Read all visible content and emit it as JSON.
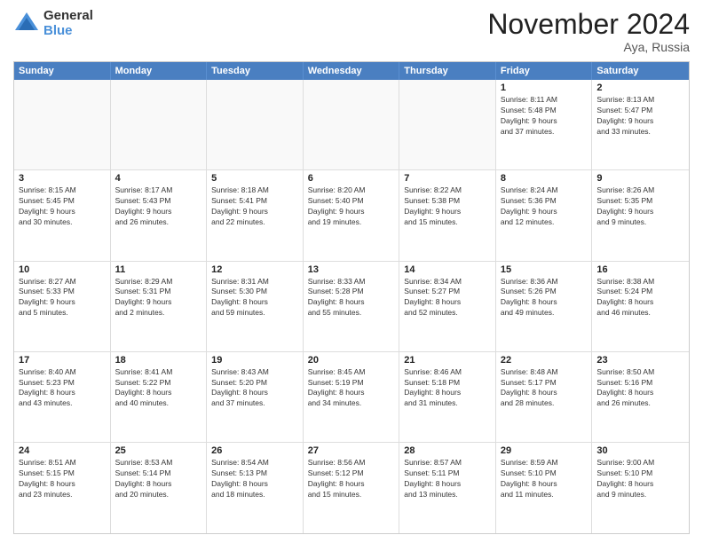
{
  "header": {
    "logo_general": "General",
    "logo_blue": "Blue",
    "title": "November 2024",
    "location": "Aya, Russia"
  },
  "calendar": {
    "days_of_week": [
      "Sunday",
      "Monday",
      "Tuesday",
      "Wednesday",
      "Thursday",
      "Friday",
      "Saturday"
    ],
    "weeks": [
      [
        {
          "day": "",
          "info": ""
        },
        {
          "day": "",
          "info": ""
        },
        {
          "day": "",
          "info": ""
        },
        {
          "day": "",
          "info": ""
        },
        {
          "day": "",
          "info": ""
        },
        {
          "day": "1",
          "info": "Sunrise: 8:11 AM\nSunset: 5:48 PM\nDaylight: 9 hours\nand 37 minutes."
        },
        {
          "day": "2",
          "info": "Sunrise: 8:13 AM\nSunset: 5:47 PM\nDaylight: 9 hours\nand 33 minutes."
        }
      ],
      [
        {
          "day": "3",
          "info": "Sunrise: 8:15 AM\nSunset: 5:45 PM\nDaylight: 9 hours\nand 30 minutes."
        },
        {
          "day": "4",
          "info": "Sunrise: 8:17 AM\nSunset: 5:43 PM\nDaylight: 9 hours\nand 26 minutes."
        },
        {
          "day": "5",
          "info": "Sunrise: 8:18 AM\nSunset: 5:41 PM\nDaylight: 9 hours\nand 22 minutes."
        },
        {
          "day": "6",
          "info": "Sunrise: 8:20 AM\nSunset: 5:40 PM\nDaylight: 9 hours\nand 19 minutes."
        },
        {
          "day": "7",
          "info": "Sunrise: 8:22 AM\nSunset: 5:38 PM\nDaylight: 9 hours\nand 15 minutes."
        },
        {
          "day": "8",
          "info": "Sunrise: 8:24 AM\nSunset: 5:36 PM\nDaylight: 9 hours\nand 12 minutes."
        },
        {
          "day": "9",
          "info": "Sunrise: 8:26 AM\nSunset: 5:35 PM\nDaylight: 9 hours\nand 9 minutes."
        }
      ],
      [
        {
          "day": "10",
          "info": "Sunrise: 8:27 AM\nSunset: 5:33 PM\nDaylight: 9 hours\nand 5 minutes."
        },
        {
          "day": "11",
          "info": "Sunrise: 8:29 AM\nSunset: 5:31 PM\nDaylight: 9 hours\nand 2 minutes."
        },
        {
          "day": "12",
          "info": "Sunrise: 8:31 AM\nSunset: 5:30 PM\nDaylight: 8 hours\nand 59 minutes."
        },
        {
          "day": "13",
          "info": "Sunrise: 8:33 AM\nSunset: 5:28 PM\nDaylight: 8 hours\nand 55 minutes."
        },
        {
          "day": "14",
          "info": "Sunrise: 8:34 AM\nSunset: 5:27 PM\nDaylight: 8 hours\nand 52 minutes."
        },
        {
          "day": "15",
          "info": "Sunrise: 8:36 AM\nSunset: 5:26 PM\nDaylight: 8 hours\nand 49 minutes."
        },
        {
          "day": "16",
          "info": "Sunrise: 8:38 AM\nSunset: 5:24 PM\nDaylight: 8 hours\nand 46 minutes."
        }
      ],
      [
        {
          "day": "17",
          "info": "Sunrise: 8:40 AM\nSunset: 5:23 PM\nDaylight: 8 hours\nand 43 minutes."
        },
        {
          "day": "18",
          "info": "Sunrise: 8:41 AM\nSunset: 5:22 PM\nDaylight: 8 hours\nand 40 minutes."
        },
        {
          "day": "19",
          "info": "Sunrise: 8:43 AM\nSunset: 5:20 PM\nDaylight: 8 hours\nand 37 minutes."
        },
        {
          "day": "20",
          "info": "Sunrise: 8:45 AM\nSunset: 5:19 PM\nDaylight: 8 hours\nand 34 minutes."
        },
        {
          "day": "21",
          "info": "Sunrise: 8:46 AM\nSunset: 5:18 PM\nDaylight: 8 hours\nand 31 minutes."
        },
        {
          "day": "22",
          "info": "Sunrise: 8:48 AM\nSunset: 5:17 PM\nDaylight: 8 hours\nand 28 minutes."
        },
        {
          "day": "23",
          "info": "Sunrise: 8:50 AM\nSunset: 5:16 PM\nDaylight: 8 hours\nand 26 minutes."
        }
      ],
      [
        {
          "day": "24",
          "info": "Sunrise: 8:51 AM\nSunset: 5:15 PM\nDaylight: 8 hours\nand 23 minutes."
        },
        {
          "day": "25",
          "info": "Sunrise: 8:53 AM\nSunset: 5:14 PM\nDaylight: 8 hours\nand 20 minutes."
        },
        {
          "day": "26",
          "info": "Sunrise: 8:54 AM\nSunset: 5:13 PM\nDaylight: 8 hours\nand 18 minutes."
        },
        {
          "day": "27",
          "info": "Sunrise: 8:56 AM\nSunset: 5:12 PM\nDaylight: 8 hours\nand 15 minutes."
        },
        {
          "day": "28",
          "info": "Sunrise: 8:57 AM\nSunset: 5:11 PM\nDaylight: 8 hours\nand 13 minutes."
        },
        {
          "day": "29",
          "info": "Sunrise: 8:59 AM\nSunset: 5:10 PM\nDaylight: 8 hours\nand 11 minutes."
        },
        {
          "day": "30",
          "info": "Sunrise: 9:00 AM\nSunset: 5:10 PM\nDaylight: 8 hours\nand 9 minutes."
        }
      ]
    ]
  }
}
